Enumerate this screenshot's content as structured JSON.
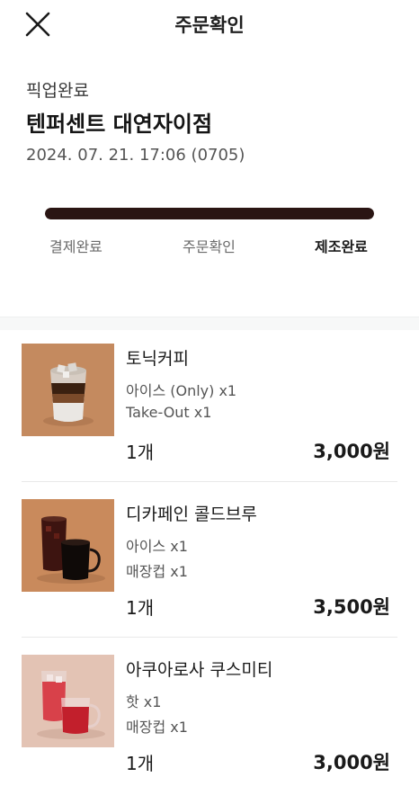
{
  "header": {
    "title": "주문확인",
    "close_icon": "close-icon"
  },
  "order": {
    "status": "픽업완료",
    "store": "텐퍼센트 대연자이점",
    "datetime": "2024. 07. 21. 17:06 (0705)"
  },
  "progress": {
    "fraction": 1.0,
    "color": "#2a1513",
    "steps": [
      "결제완료",
      "주문확인",
      "제조완료"
    ],
    "active_step": "제조완료"
  },
  "items": [
    {
      "name": "토닉커피",
      "option1": "아이스 (Only) x1",
      "option2": "Take-Out x1",
      "qty": "1개",
      "price": "3,000원"
    },
    {
      "name": "디카페인 콜드브루",
      "option1": "아이스 x1",
      "option2": "매장컵 x1",
      "qty": "1개",
      "price": "3,500원"
    },
    {
      "name": "아쿠아로사 쿠스미티",
      "option1": "핫 x1",
      "option2": "매장컵 x1",
      "qty": "1개",
      "price": "3,000원"
    }
  ]
}
